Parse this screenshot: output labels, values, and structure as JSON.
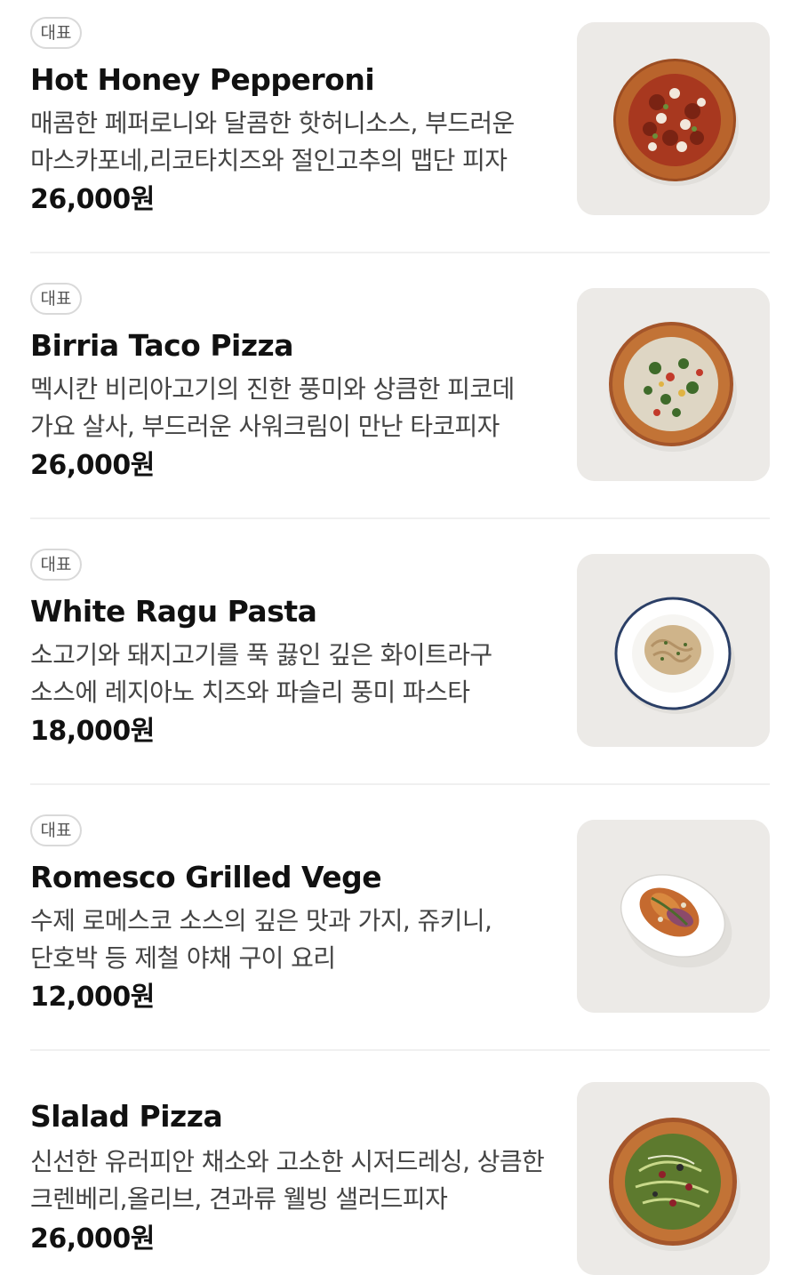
{
  "menu": {
    "badge_label": "대표",
    "items": [
      {
        "name": "Hot Honey Pepperoni",
        "description": "매콤한 페퍼로니와 달콤한 핫허니소스, 부드러운 마스카포네,리코타치즈와 절인고추의 맵단 피자",
        "price": "26,000원",
        "image": "pizza-pepperoni-photo"
      },
      {
        "name": "Birria Taco Pizza",
        "description": "멕시칸 비리아고기의 진한 풍미와 상큼한 피코데 가요 살사, 부드러운 사워크림이 만난 타코피자",
        "price": "26,000원",
        "image": "pizza-taco-photo"
      },
      {
        "name": "White Ragu Pasta",
        "description": "소고기와 돼지고기를 푹 끓인 깊은 화이트라구 소스에 레지아노 치즈와 파슬리 풍미 파스타",
        "price": "18,000원",
        "image": "pasta-bowl-photo"
      },
      {
        "name": "Romesco Grilled Vege",
        "description": "수제 로메스코 소스의 깊은 맛과 가지, 쥬키니, 단호박 등 제철 야채 구이 요리",
        "price": "12,000원",
        "image": "grilled-vegetable-plate-photo"
      },
      {
        "name": "Slalad Pizza",
        "description": "신선한 유러피안 채소와 고소한 시저드레싱, 상큼한 크렌베리,올리브, 견과류 웰빙 샐러드피자",
        "price": "26,000원",
        "image": "pizza-salad-photo"
      }
    ]
  }
}
